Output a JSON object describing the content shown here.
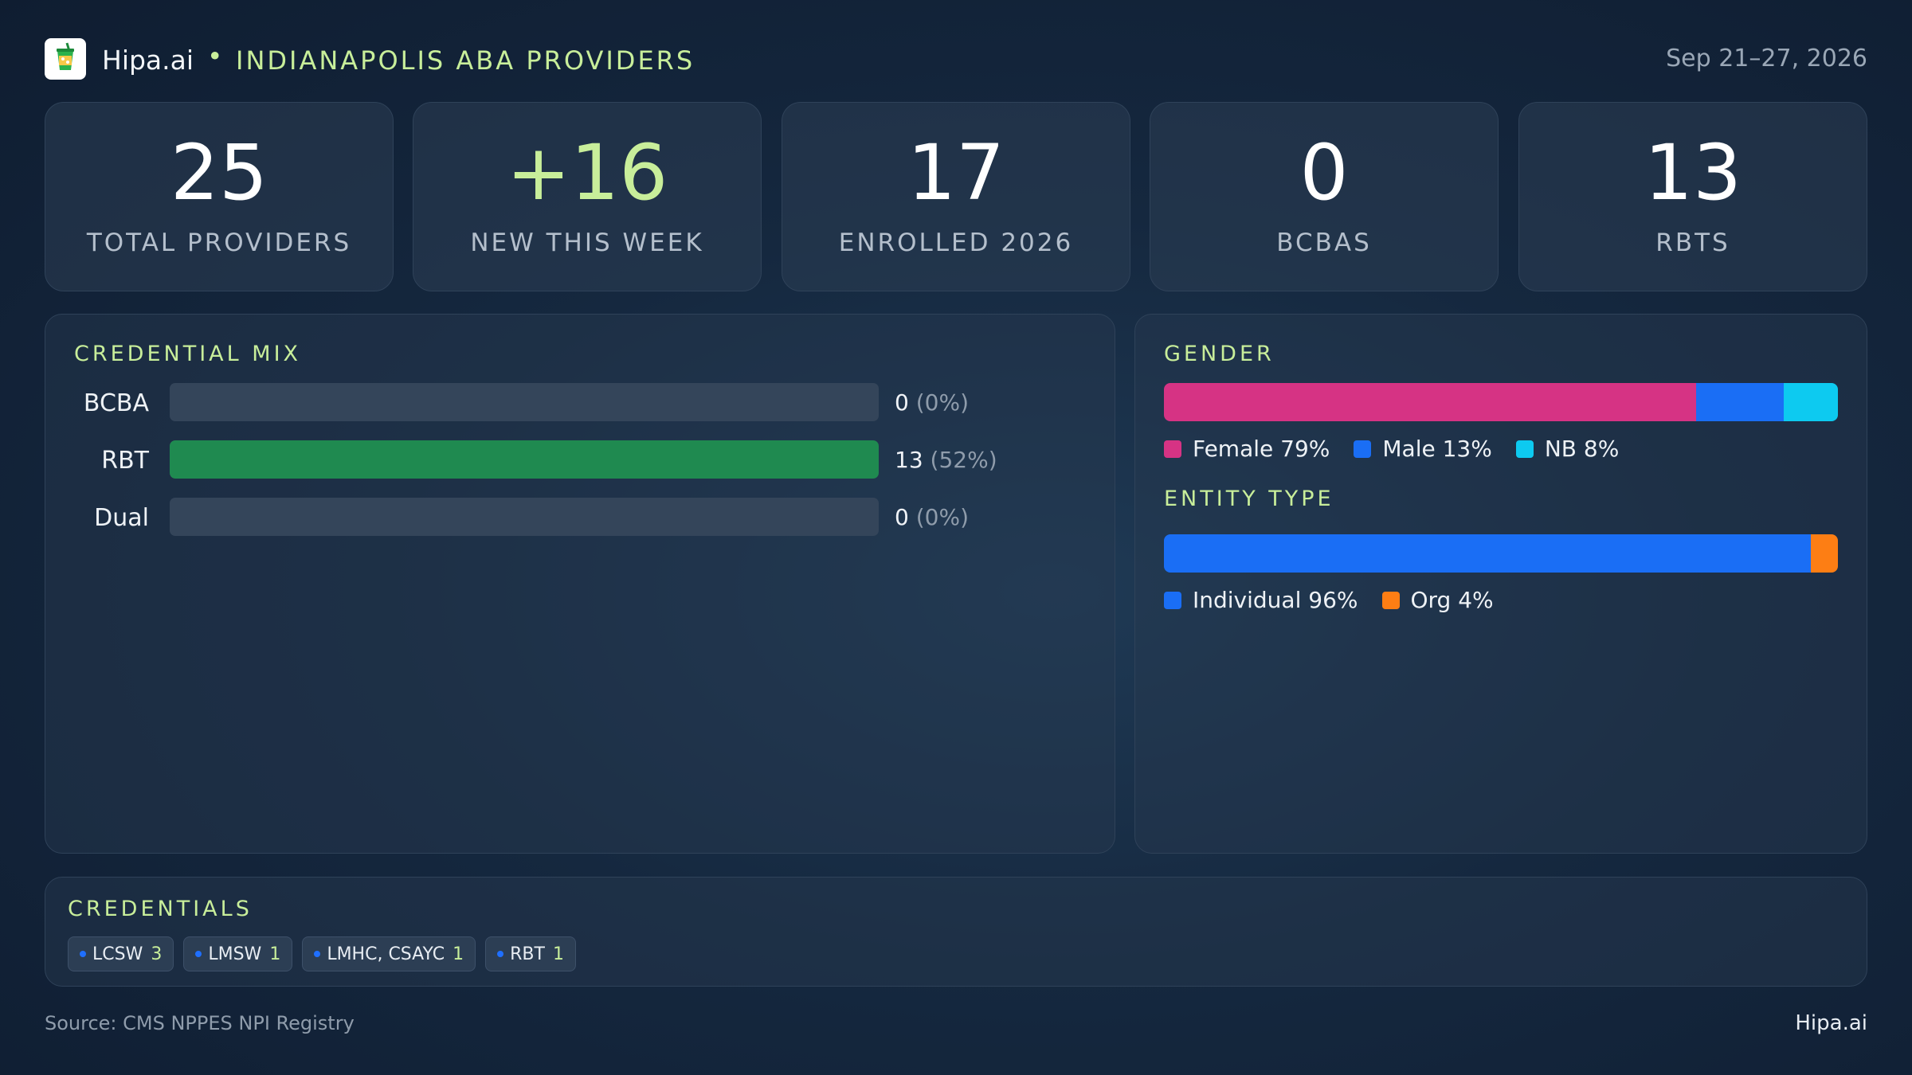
{
  "header": {
    "brand": "Hipa.ai",
    "separator": "•",
    "subtitle": "INDIANAPOLIS ABA PROVIDERS",
    "date_range": "Sep 21–27, 2026",
    "logo_icon": "cocktail-glass-icon"
  },
  "stats": [
    {
      "value": "25",
      "label": "TOTAL PROVIDERS"
    },
    {
      "value": "+16",
      "label": "NEW THIS WEEK"
    },
    {
      "value": "17",
      "label": "ENROLLED 2026"
    },
    {
      "value": "0",
      "label": "BCBAS"
    },
    {
      "value": "13",
      "label": "RBTS"
    }
  ],
  "credential_mix": {
    "title": "CREDENTIAL MIX",
    "rows": [
      {
        "label": "BCBA",
        "count": "0",
        "pct": "(0%)",
        "fraction": 0
      },
      {
        "label": "RBT",
        "count": "13",
        "pct": "(52%)",
        "fraction": 1
      },
      {
        "label": "Dual",
        "count": "0",
        "pct": "(0%)",
        "fraction": 0
      }
    ],
    "bar_color": "#1f8a50",
    "track_color": "#34455a"
  },
  "gender": {
    "title": "GENDER",
    "segments": [
      {
        "label": "Female 79%",
        "share": 79,
        "color": "#d63384"
      },
      {
        "label": "Male 13%",
        "share": 13,
        "color": "#1a6ef5"
      },
      {
        "label": "NB 8%",
        "share": 8,
        "color": "#0dcaf0"
      }
    ]
  },
  "entity_type": {
    "title": "ENTITY TYPE",
    "segments": [
      {
        "label": "Individual 96%",
        "share": 96,
        "color": "#1a6ef5"
      },
      {
        "label": "Org 4%",
        "share": 4,
        "color": "#fd7e14"
      }
    ]
  },
  "credentials": {
    "title": "CREDENTIALS",
    "chips": [
      {
        "label": "LCSW",
        "count": "3"
      },
      {
        "label": "LMSW",
        "count": "1"
      },
      {
        "label": "LMHC, CSAYC",
        "count": "1"
      },
      {
        "label": "RBT",
        "count": "1"
      }
    ]
  },
  "footer": {
    "source": "Source: CMS NPPES NPI Registry",
    "brand": "Hipa.ai"
  },
  "colors": {
    "accent": "#c8ee9a",
    "background": "#15283f"
  }
}
